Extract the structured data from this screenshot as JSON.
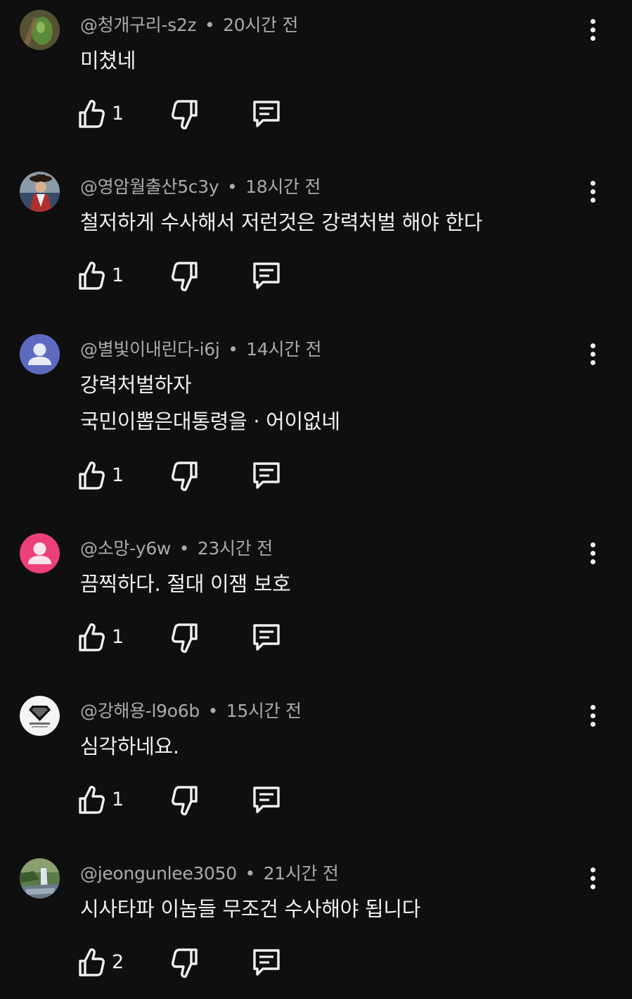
{
  "comments": [
    {
      "author": "@청개구리-s2z",
      "separator": "•",
      "time": "20시간 전",
      "lines": [
        "미쳤네"
      ],
      "likes": "1",
      "avatar": "frog-photo-avatar",
      "avatar_color": "#5b7a3a"
    },
    {
      "author": "@영암월출산5c3y",
      "separator": "•",
      "time": "18시간 전",
      "lines": [
        "철저하게 수사해서 저런것은 강력처벌 해야 한다"
      ],
      "likes": "1",
      "avatar": "person-in-hanbok-avatar",
      "avatar_color": "#7a5a48"
    },
    {
      "author": "@별빛이내린다-i6j",
      "separator": "•",
      "time": "14시간 전",
      "lines": [
        "강력처벌하자",
        "국민이뽑은대통령을 · 어이없네"
      ],
      "likes": "1",
      "avatar": "default-user-avatar",
      "avatar_color": "#5c6bc0"
    },
    {
      "author": "@소망-y6w",
      "separator": "•",
      "time": "23시간 전",
      "lines": [
        "끔찍하다. 절대 이잼 보호"
      ],
      "likes": "1",
      "avatar": "default-user-avatar",
      "avatar_color": "#ec407a"
    },
    {
      "author": "@강해용-l9o6b",
      "separator": "•",
      "time": "15시간 전",
      "lines": [
        "심각하네요."
      ],
      "likes": "1",
      "avatar": "diamond-logo-avatar",
      "avatar_color": "#f5f5f5"
    },
    {
      "author": "@jeongunlee3050",
      "separator": "•",
      "time": "21시간 전",
      "lines": [
        "시사타파 이놈들 무조건 수사해야 됩니다"
      ],
      "likes": "2",
      "avatar": "waterfall-landscape-avatar",
      "avatar_color": "#4a6a3a"
    }
  ],
  "icons": {
    "like": "thumbs-up-icon",
    "dislike": "thumbs-down-icon",
    "reply": "reply-icon",
    "menu": "more-vert-icon"
  },
  "colors": {
    "background": "#0f0f0f",
    "text": "#f1f1f1",
    "meta": "#aaaaaa"
  }
}
